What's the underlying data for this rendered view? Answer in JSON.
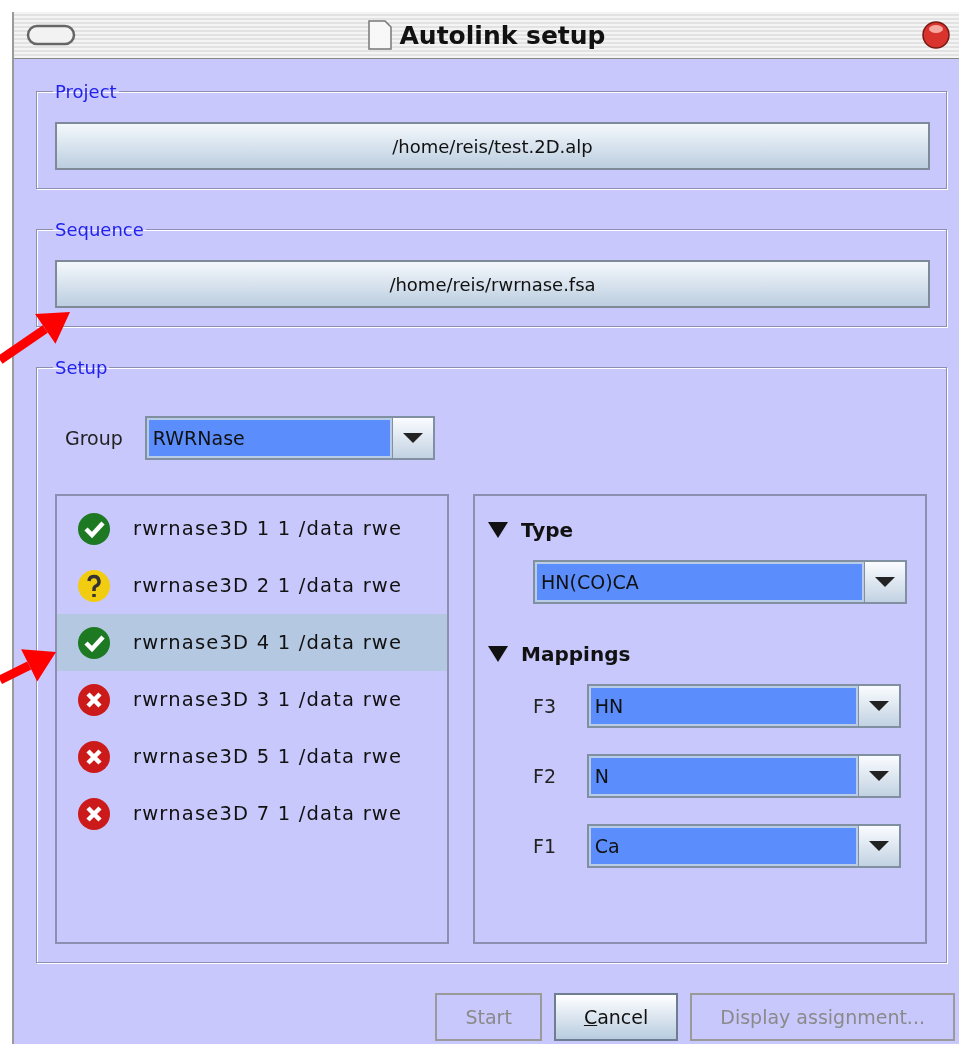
{
  "window": {
    "title": "Autolink setup"
  },
  "project": {
    "legend": "Project",
    "path": "/home/reis/test.2D.alp"
  },
  "sequence": {
    "legend": "Sequence",
    "path": "/home/reis/rwrnase.fsa"
  },
  "setup": {
    "legend": "Setup",
    "group": {
      "label": "Group",
      "value": "RWRNase"
    },
    "experiments": [
      {
        "kind": "ok",
        "label": "rwrnase3D 1 1 /data rwe",
        "selected": false
      },
      {
        "kind": "unknown",
        "label": "rwrnase3D 2 1 /data rwe",
        "selected": false
      },
      {
        "kind": "ok",
        "label": "rwrnase3D 4 1 /data rwe",
        "selected": true
      },
      {
        "kind": "error",
        "label": "rwrnase3D 3 1 /data rwe",
        "selected": false
      },
      {
        "kind": "error",
        "label": "rwrnase3D 5 1 /data rwe",
        "selected": false
      },
      {
        "kind": "error",
        "label": "rwrnase3D 7 1 /data rwe",
        "selected": false
      }
    ],
    "type": {
      "title": "Type",
      "expanded": true,
      "value": "HN(CO)CA"
    },
    "mappings": {
      "title": "Mappings",
      "expanded": true,
      "rows": [
        {
          "label": "F3",
          "value": "HN"
        },
        {
          "label": "F2",
          "value": "N"
        },
        {
          "label": "F1",
          "value": "Ca"
        }
      ]
    }
  },
  "buttons": [
    {
      "label": "Start",
      "disabled": true,
      "underline_first": false
    },
    {
      "label": "Cancel",
      "disabled": false,
      "underline_first": true
    },
    {
      "label": "Display assignment...",
      "disabled": true,
      "underline_first": false
    }
  ],
  "annotations": [
    {
      "kind": "arrow"
    },
    {
      "kind": "arrow"
    }
  ]
}
